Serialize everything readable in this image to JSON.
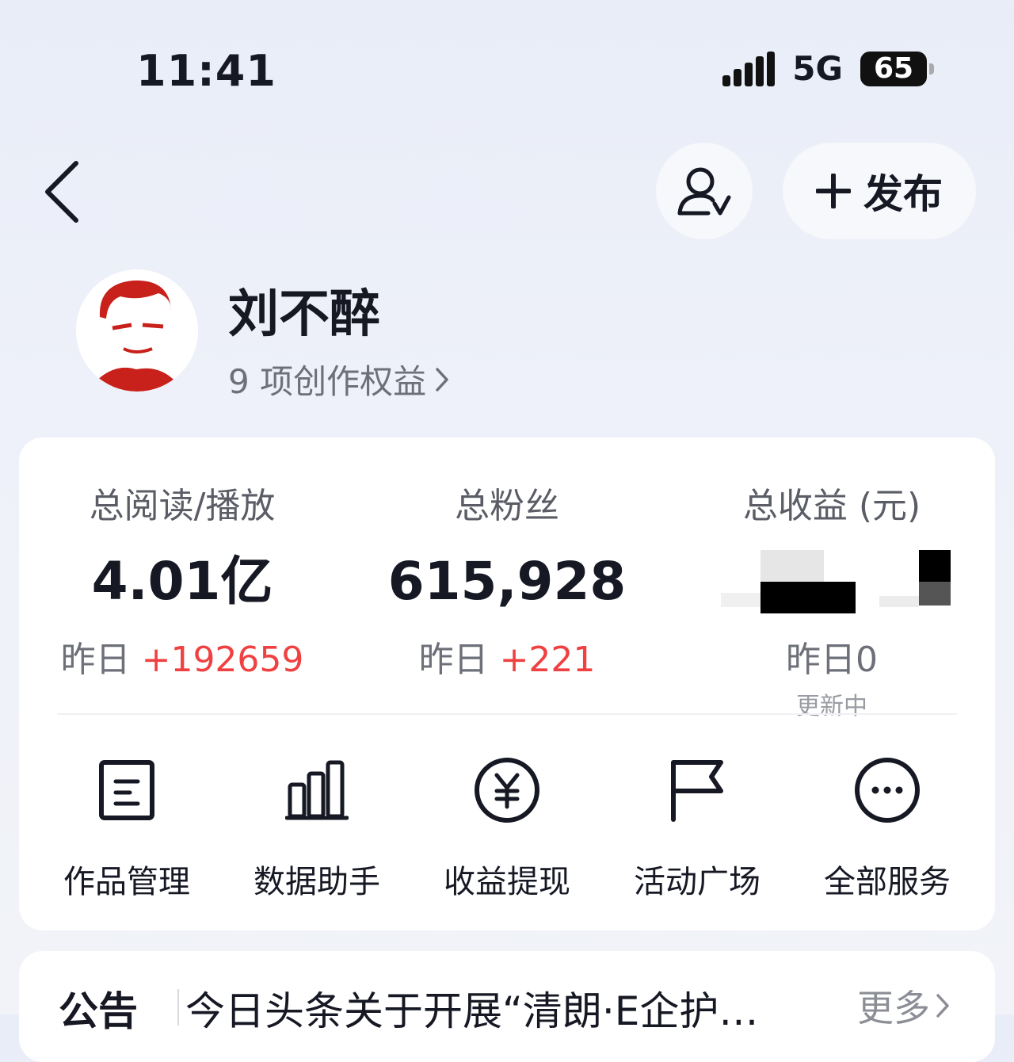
{
  "status_bar": {
    "time": "11:41",
    "network": "5G",
    "battery": "65"
  },
  "header": {
    "publish_label": "发布"
  },
  "profile": {
    "name": "刘不醉",
    "rights_link": "9 项创作权益"
  },
  "stats": [
    {
      "label": "总阅读/播放",
      "value": "4.01亿",
      "delta_prefix": "昨日",
      "delta_value": "+192659"
    },
    {
      "label": "总粉丝",
      "value": "615,928",
      "delta_prefix": "昨日",
      "delta_value": "+221"
    },
    {
      "label": "总收益 (元)",
      "value": "",
      "delta_prefix": "昨日",
      "delta_value": "0",
      "note": "更新中"
    }
  ],
  "tools": [
    {
      "label": "作品管理",
      "icon": "document-icon"
    },
    {
      "label": "数据助手",
      "icon": "bar-chart-icon"
    },
    {
      "label": "收益提现",
      "icon": "yen-coin-icon"
    },
    {
      "label": "活动广场",
      "icon": "flag-icon"
    },
    {
      "label": "全部服务",
      "icon": "more-dots-icon"
    }
  ],
  "notice": {
    "tag": "公告",
    "text": "今日头条关于开展“清朗·E企护…",
    "more": "更多"
  },
  "colors": {
    "accent_red": "#f04142",
    "text_primary": "#161823",
    "text_secondary": "#6e7079"
  }
}
